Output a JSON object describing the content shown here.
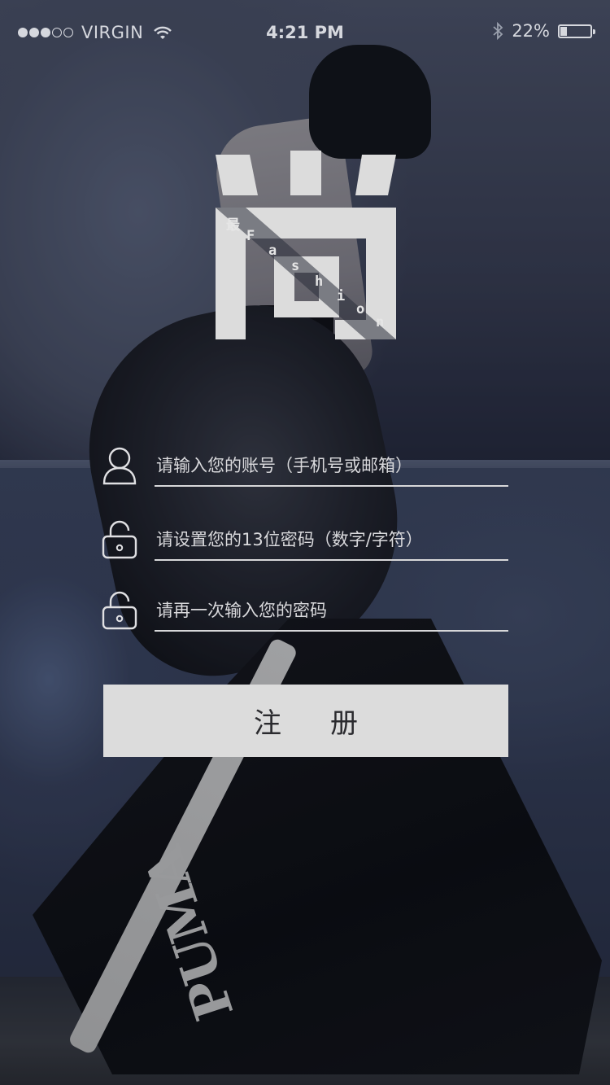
{
  "status_bar": {
    "signal_filled": 3,
    "signal_total": 5,
    "carrier": "VIRGIN",
    "time": "4:21 PM",
    "battery_percent": "22%",
    "battery_level": 0.22
  },
  "logo": {
    "main_glyph": "尚",
    "sub_glyphs": [
      "最",
      "F",
      "a",
      "s",
      "h",
      "i",
      "o",
      "n"
    ]
  },
  "form": {
    "account_placeholder": "请输入您的账号（手机号或邮箱）",
    "password_placeholder": "请设置您的13位密码（数字/字符）",
    "confirm_placeholder": "请再一次输入您的密码",
    "submit_label": "注册"
  },
  "background": {
    "brand_text": "PUMA"
  },
  "colors": {
    "button_bg": "#dcdcdc",
    "underline": "#d7d7d9",
    "text": "#e3e3e6"
  }
}
